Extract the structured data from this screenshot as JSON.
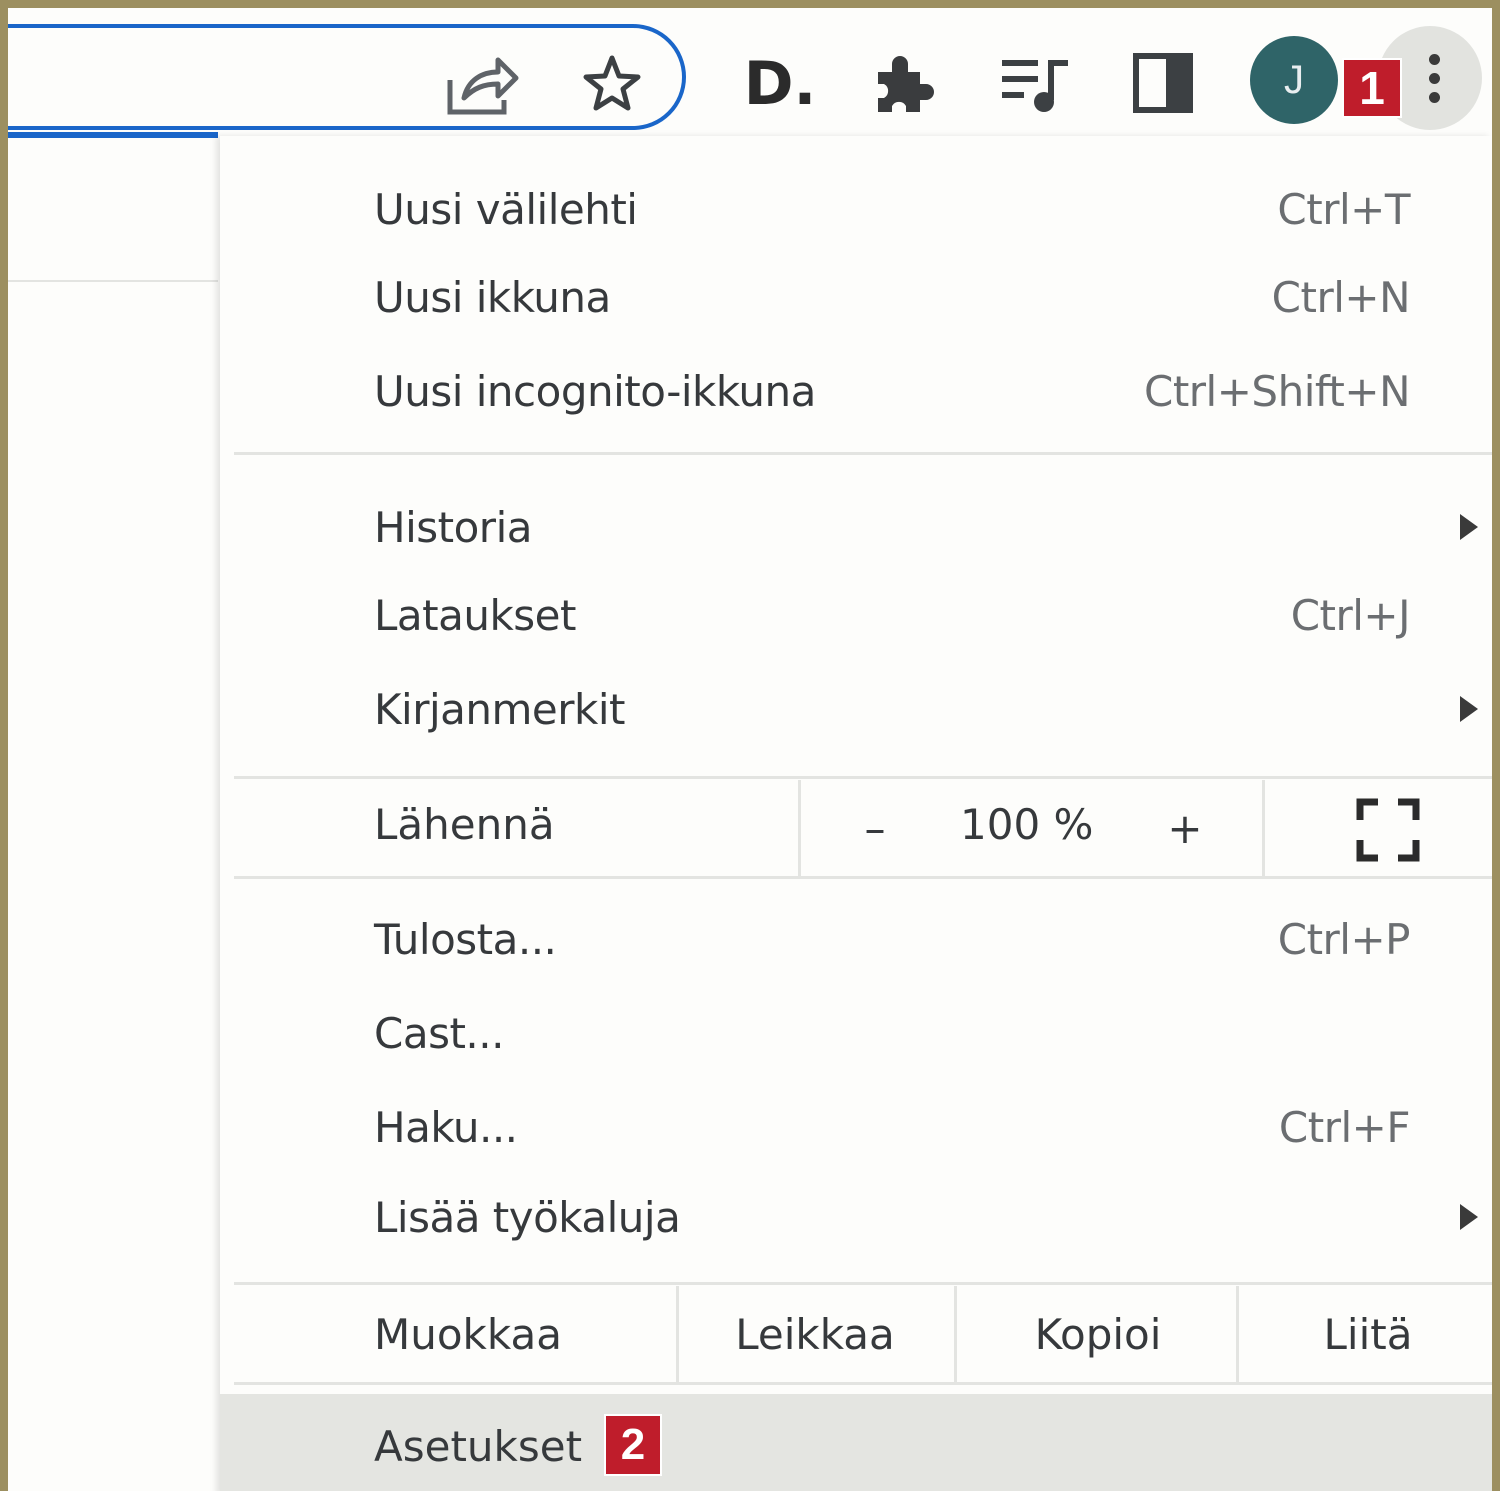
{
  "toolbar": {
    "icons": [
      "share-icon",
      "star-icon",
      "d-extension-icon",
      "puzzle-icon",
      "media-control-icon",
      "side-panel-icon",
      "kebab-menu-icon"
    ],
    "d_logo_text": "D.",
    "avatar_letter": "J",
    "step_badge_1": "1",
    "accent_color": "#1a66c9"
  },
  "menu": {
    "group1": [
      {
        "label": "Uusi välilehti",
        "shortcut": "Ctrl+T"
      },
      {
        "label": "Uusi ikkuna",
        "shortcut": "Ctrl+N"
      },
      {
        "label": "Uusi incognito-ikkuna",
        "shortcut": "Ctrl+Shift+N"
      }
    ],
    "group2": [
      {
        "label": "Historia",
        "shortcut": "",
        "submenu": true
      },
      {
        "label": "Lataukset",
        "shortcut": "Ctrl+J"
      },
      {
        "label": "Kirjanmerkit",
        "shortcut": "",
        "submenu": true
      }
    ],
    "zoom": {
      "label": "Lähennä",
      "minus": "–",
      "value": "100 %",
      "plus": "+"
    },
    "group3": [
      {
        "label": "Tulosta...",
        "shortcut": "Ctrl+P"
      },
      {
        "label": "Cast...",
        "shortcut": ""
      },
      {
        "label": "Haku...",
        "shortcut": "Ctrl+F"
      },
      {
        "label": "Lisää työkaluja",
        "shortcut": "",
        "submenu": true
      }
    ],
    "edit": {
      "label": "Muokkaa",
      "cut": "Leikkaa",
      "copy": "Kopioi",
      "paste": "Liitä"
    },
    "settings": {
      "label": "Asetukset",
      "step_badge_2": "2"
    }
  },
  "colors": {
    "badge": "#bf1d2b",
    "avatar": "#2f6468",
    "highlight": "#e4e5e1"
  }
}
